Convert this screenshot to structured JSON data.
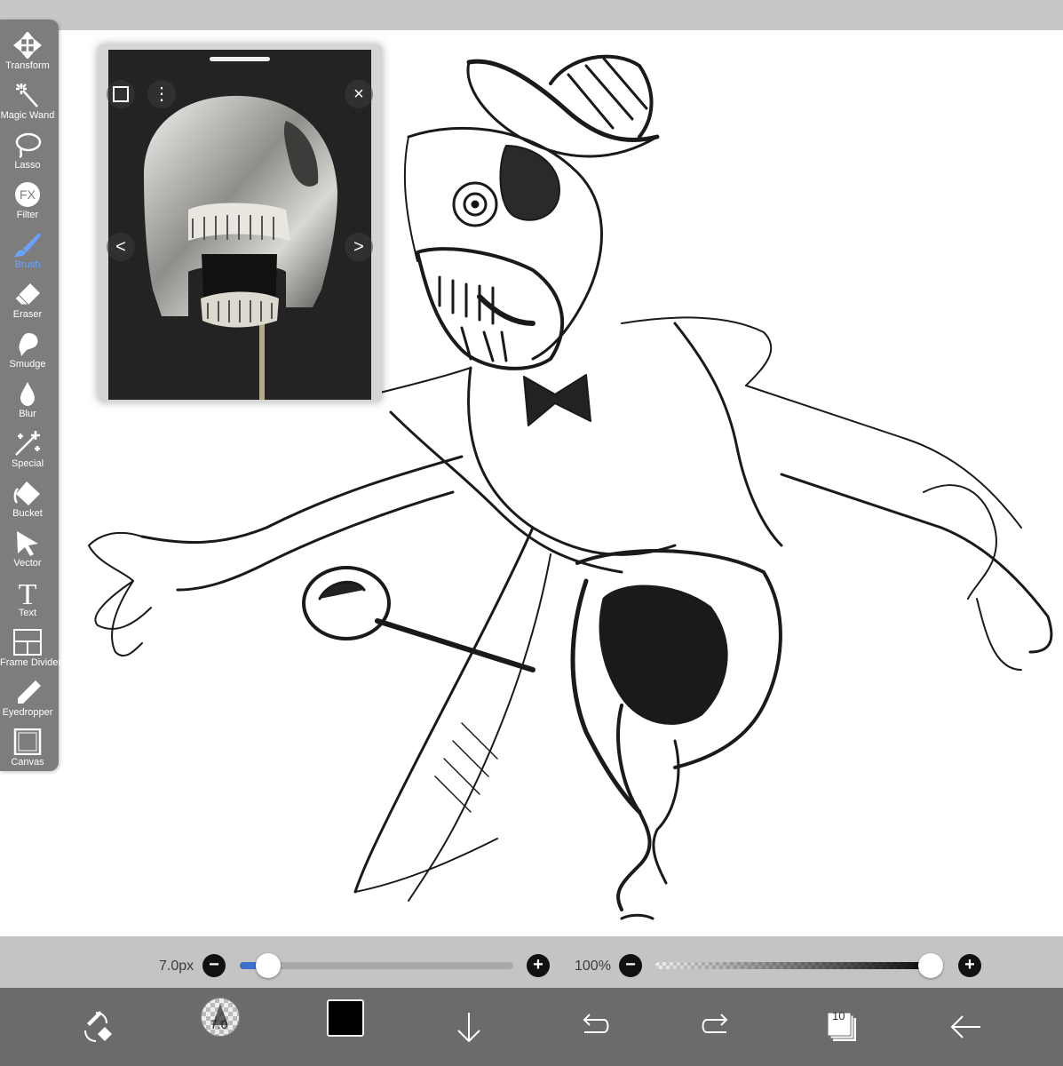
{
  "toolbar": {
    "tools": [
      {
        "label": "Transform",
        "icon": "move-arrows-icon"
      },
      {
        "label": "Magic Wand",
        "icon": "magic-wand-icon"
      },
      {
        "label": "Lasso",
        "icon": "lasso-icon"
      },
      {
        "label": "Filter",
        "icon": "fx-icon"
      },
      {
        "label": "Brush",
        "icon": "brush-icon",
        "active": true
      },
      {
        "label": "Eraser",
        "icon": "eraser-icon"
      },
      {
        "label": "Smudge",
        "icon": "smudge-icon"
      },
      {
        "label": "Blur",
        "icon": "drop-icon"
      },
      {
        "label": "Special",
        "icon": "sparkle-icon"
      },
      {
        "label": "Bucket",
        "icon": "bucket-icon"
      },
      {
        "label": "Vector",
        "icon": "cursor-arrow-icon"
      },
      {
        "label": "Text",
        "icon": "text-icon"
      },
      {
        "label": "Frame Divider",
        "icon": "frame-divider-icon"
      },
      {
        "label": "Eyedropper",
        "icon": "eyedropper-icon"
      },
      {
        "label": "Canvas",
        "icon": "canvas-icon"
      }
    ],
    "fx_glyph": "FX",
    "text_glyph": "T",
    "active_color": "#6aa2ff"
  },
  "reference": {
    "prev_glyph": "<",
    "next_glyph": ">",
    "close_glyph": "×",
    "menu_glyph": "⋮"
  },
  "brush_size": {
    "value_label": "7.0px",
    "minus": "−",
    "plus": "+",
    "fraction": 0.06
  },
  "opacity": {
    "value_label": "100%",
    "minus": "−",
    "plus": "+",
    "fraction": 1.0
  },
  "bottom": {
    "brush_size_badge": "7.0",
    "color": "#000000",
    "layers_count": "10"
  }
}
